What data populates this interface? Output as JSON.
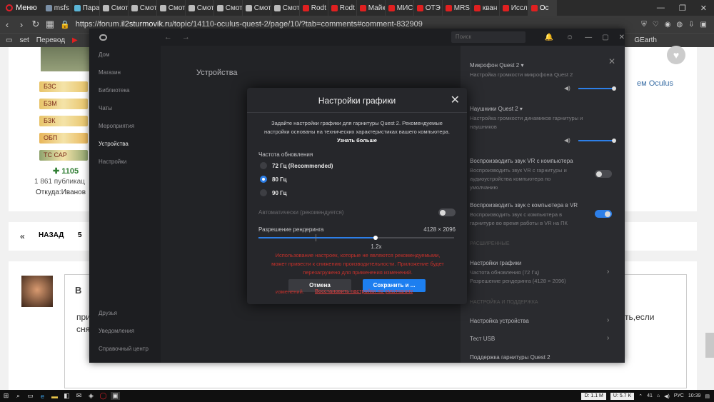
{
  "browser": {
    "menu_label": "Меню",
    "tabs": [
      {
        "label": "msfs",
        "color": "#7a8fa6"
      },
      {
        "label": "Пара",
        "color": "#5bb5d6"
      },
      {
        "label": "Смот",
        "color": "#bbbbbb"
      },
      {
        "label": "Смот",
        "color": "#bbbbbb"
      },
      {
        "label": "Смот",
        "color": "#bbbbbb"
      },
      {
        "label": "Смот",
        "color": "#bbbbbb"
      },
      {
        "label": "Смот",
        "color": "#bbbbbb"
      },
      {
        "label": "Смот",
        "color": "#bbbbbb"
      },
      {
        "label": "Смот",
        "color": "#bbbbbb"
      },
      {
        "label": "Rodt",
        "color": "#e02020"
      },
      {
        "label": "Rodt",
        "color": "#e02020"
      },
      {
        "label": "Майк",
        "color": "#e02020"
      },
      {
        "label": "МИС",
        "color": "#e02020"
      },
      {
        "label": "ОТЭ",
        "color": "#e02020"
      },
      {
        "label": "MRS",
        "color": "#e02020"
      },
      {
        "label": "кван",
        "color": "#e02020"
      },
      {
        "label": "Иссл",
        "color": "#e02020"
      },
      {
        "label": "Oc",
        "color": "#e02020"
      }
    ],
    "url_prefix": "https://forum.",
    "url_domain": "il2sturmovik.ru",
    "url_path": "/topic/14110-oculus-quest-2/page/10/?tab=comments#comment-832909",
    "bookmarks": [
      "set",
      "Перевод",
      "GEarth"
    ],
    "search_placeholder": "Поиск"
  },
  "forum": {
    "badges": [
      {
        "label": "БЗС",
        "color": "#e8c46a"
      },
      {
        "label": "БЗМ",
        "color": "#e8c46a"
      },
      {
        "label": "БЗК",
        "color": "#e8c46a"
      },
      {
        "label": "ОБП",
        "color": "#e8b65a"
      },
      {
        "label": "ТС САР",
        "color": "#8ea36e"
      }
    ],
    "reputation": "1105",
    "posts": "1 861 публикац",
    "from": "Откуда:Иванов",
    "oculus_link": "ем Oculus",
    "back_label": "НАЗАД",
    "page_num": "5",
    "reply_letter": "B",
    "reply_text_1": "при",
    "reply_text_2": "сня",
    "reply_right": "ть,если"
  },
  "oculus": {
    "sidebar": [
      "Дом",
      "Магазин",
      "Библиотека",
      "Чаты",
      "Мероприятия",
      "Устройства",
      "Настройки"
    ],
    "sidebar_bottom": [
      "Друзья",
      "Уведомления",
      "Справочный центр"
    ],
    "main_title": "Устройства",
    "right": {
      "mic_title": "Микрофон Quest 2",
      "mic_sub": "Настройка громкости микрофона Quest 2",
      "head_title": "Наушники Quest 2",
      "head_sub": "Настройка громкости динамиков гарнитуры и наушников",
      "pc_audio_title": "Воспроизводить звук VR с компьютера",
      "pc_audio_sub": "Воспроизводить звук VR с гарнитуры и аудиоустройства компьютера по умолчанию",
      "vr_audio_title": "Воспроизводить звук с компьютера в VR",
      "vr_audio_sub": "Воспроизводить звук с компьютера в гарнитуре во время работы в VR на ПК",
      "section_advanced": "РАСШИРЕННЫЕ",
      "gfx_title": "Настройки графики",
      "gfx_sub1": "Частота обновления (72 Гц)",
      "gfx_sub2": "Разрешение рендеринга (4128 × 2096)",
      "section_support": "НАСТРОЙКА И ПОДДЕРЖКА",
      "device_setup": "Настройка устройства",
      "usb_test": "Тест USB",
      "support_quest": "Поддержка гарнитуры Quest 2"
    }
  },
  "dialog": {
    "title": "Настройки графики",
    "desc": "Задайте настройки графики для гарнитуры Quest 2. Рекомендуемые настройки основаны на технических характеристиках вашего компьютера.",
    "learn_more": "Узнать больше",
    "refresh_label": "Частота обновления",
    "options": [
      "72 Гц (Recommended)",
      "80 Гц",
      "90 Гц"
    ],
    "selected_index": 1,
    "auto_label": "Автоматически (рекомендуется)",
    "res_label": "Разрешение рендеринга",
    "res_value": "4128 × 2096",
    "res_scale": "1.2x",
    "res_fraction": 0.6,
    "warning": "Использование настроек, которые не являются рекомендуемыми, может привести к снижению производительности. Приложение будет перезагружено для применения изменений.",
    "cancel": "Отмена",
    "save": "Сохранить и ...",
    "restore": "Восстановить настройки по умолчанию",
    "restore_prefix": "изменений."
  },
  "taskbar": {
    "download": "D: 1.1 M",
    "upload": "U: 5.7 K",
    "temp": "41",
    "lang": "РУС",
    "time": "10:39"
  }
}
